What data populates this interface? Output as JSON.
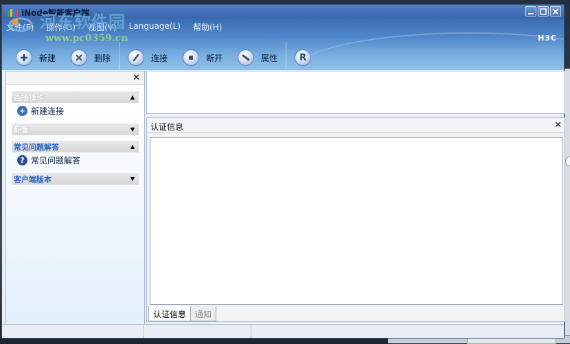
{
  "window": {
    "title": "iNode智能客户端",
    "brand": "H3C"
  },
  "menu": [
    "文件(F)",
    "操作(O)",
    "视图(V)",
    "Language(L)",
    "帮助(H)"
  ],
  "toolbar": {
    "new_label": "新建",
    "delete_label": "删除",
    "connect_label": "连接",
    "disconnect_label": "断开",
    "properties_label": "属性"
  },
  "sidebar": {
    "groups": [
      {
        "title": "连接操作",
        "items": [
          "新建连接"
        ]
      },
      {
        "title": "配置",
        "items": []
      },
      {
        "title": "常见问题解答",
        "items": [
          "常见问题解答"
        ]
      },
      {
        "title": "客户端版本",
        "items": []
      }
    ]
  },
  "auth_panel": {
    "title": "认证信息",
    "tabs": [
      "认证信息",
      "通知"
    ]
  },
  "watermark": {
    "text": "河东软件园",
    "url": "www.pc0359.cn"
  },
  "icons": {
    "new": "plus-circle-icon",
    "delete": "x-circle-icon",
    "connect": "plug-icon",
    "disconnect": "stop-icon",
    "properties": "wrench-icon",
    "r": "r-badge-icon",
    "help": "question-circle-icon"
  }
}
